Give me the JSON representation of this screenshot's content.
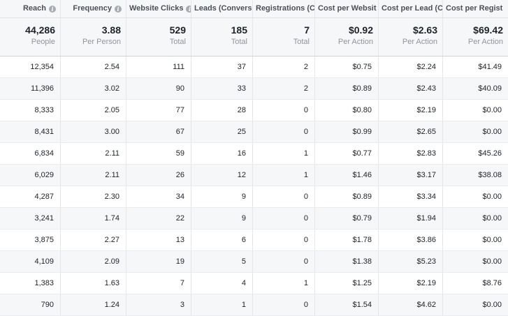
{
  "headers": [
    {
      "label": "Reach",
      "info": true
    },
    {
      "label": "Frequency",
      "info": true
    },
    {
      "label": "Website Clicks",
      "info": true
    },
    {
      "label": "Leads (Conversi",
      "info": false
    },
    {
      "label": "Registrations (C",
      "info": false
    },
    {
      "label": "Cost per Websit",
      "info": true
    },
    {
      "label": "Cost per Lead (C",
      "info": false
    },
    {
      "label": "Cost per Regist",
      "info": false
    }
  ],
  "summary": [
    {
      "value": "44,286",
      "sub": "People"
    },
    {
      "value": "3.88",
      "sub": "Per Person"
    },
    {
      "value": "529",
      "sub": "Total"
    },
    {
      "value": "185",
      "sub": "Total"
    },
    {
      "value": "7",
      "sub": "Total"
    },
    {
      "value": "$0.92",
      "sub": "Per Action"
    },
    {
      "value": "$2.63",
      "sub": "Per Action"
    },
    {
      "value": "$69.42",
      "sub": "Per Action"
    }
  ],
  "rows": [
    [
      "12,354",
      "2.54",
      "111",
      "37",
      "2",
      "$0.75",
      "$2.24",
      "$41.49"
    ],
    [
      "11,396",
      "3.02",
      "90",
      "33",
      "2",
      "$0.89",
      "$2.43",
      "$40.09"
    ],
    [
      "8,333",
      "2.05",
      "77",
      "28",
      "0",
      "$0.80",
      "$2.19",
      "$0.00"
    ],
    [
      "8,431",
      "3.00",
      "67",
      "25",
      "0",
      "$0.99",
      "$2.65",
      "$0.00"
    ],
    [
      "6,834",
      "2.11",
      "59",
      "16",
      "1",
      "$0.77",
      "$2.83",
      "$45.26"
    ],
    [
      "6,029",
      "2.11",
      "26",
      "12",
      "1",
      "$1.46",
      "$3.17",
      "$38.08"
    ],
    [
      "4,287",
      "2.30",
      "34",
      "9",
      "0",
      "$0.89",
      "$3.34",
      "$0.00"
    ],
    [
      "3,241",
      "1.74",
      "22",
      "9",
      "0",
      "$0.79",
      "$1.94",
      "$0.00"
    ],
    [
      "3,875",
      "2.27",
      "13",
      "6",
      "0",
      "$1.78",
      "$3.86",
      "$0.00"
    ],
    [
      "4,109",
      "2.09",
      "19",
      "5",
      "0",
      "$1.38",
      "$5.23",
      "$0.00"
    ],
    [
      "1,383",
      "1.63",
      "7",
      "4",
      "1",
      "$1.25",
      "$2.19",
      "$8.76"
    ],
    [
      "790",
      "1.24",
      "3",
      "1",
      "0",
      "$1.54",
      "$4.62",
      "$0.00"
    ]
  ],
  "colors": {
    "header_bg": "#f6f7f9",
    "stripe_bg": "#f6f7f9",
    "border": "#e4e6ea",
    "text": "#1d2129",
    "muted": "#90949c"
  }
}
